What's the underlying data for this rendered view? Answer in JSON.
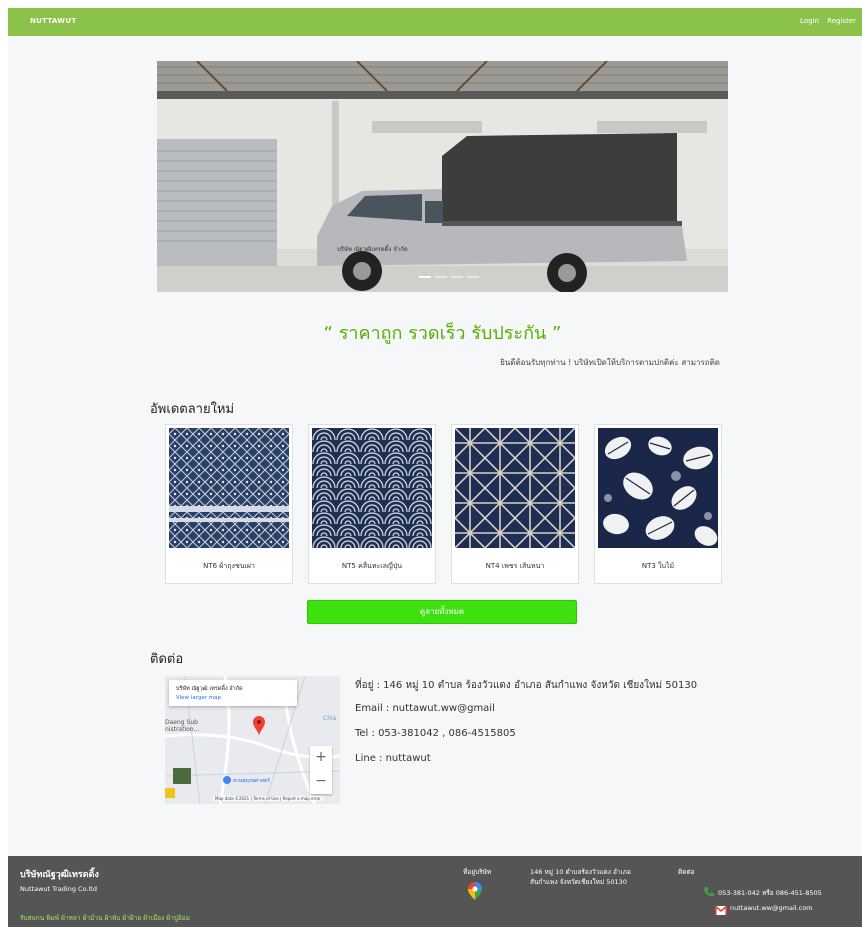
{
  "nav": {
    "brand": "NUTTAWUT",
    "login": "Login",
    "register": "Register"
  },
  "hero": {
    "truck_sign": "บริษัท ณัฐวุฒิเทรดดิ้ง จำกัด",
    "slides_count": 4,
    "active_slide": 1
  },
  "slogan": "“ ราคาถูก รวดเร็ว รับประกัน ”",
  "welcome": "ยินดีต้อนรับทุกท่าน ! บริษัทเปิดให้บริการตามปกติค่ะ สามารถติด",
  "new_patterns": {
    "heading": "อัพเดตลายใหม่",
    "items": [
      {
        "caption": "NT6  ผ้าถุงชนเผ่า"
      },
      {
        "caption": "NT5  คลื่นทะเลญี่ปุ่น"
      },
      {
        "caption": "NT4  เพชร เส้นหนา"
      },
      {
        "caption": "NT3  ใบไม้"
      }
    ],
    "view_all": "ดูลายทั้งหมด"
  },
  "contact": {
    "heading": "ติดต่อ",
    "address": "ที่อยู่ : 146 หมู่ 10 ตำบล ร้องวัวแดง อำเภอ สันกำแพง จังหวัด เชียงใหม่ 50130",
    "email": "Email : nuttawut.ww@gmail",
    "tel": "Tel : 053-381042 , 086-4515805",
    "line": "Line : nuttawut"
  },
  "map": {
    "place_title": "บริษัท ณัฐวุฒิ เทรดดิ้ง จำกัด",
    "view_larger": "View larger map",
    "zoom_in": "+",
    "zoom_out": "−",
    "footer": "Map data ©2021  |  Terms of Use  |  Report a map error",
    "label_left": "Daeng Sub",
    "label_left2": "nistration...",
    "label_chia": "Chia",
    "label_poi": "สวนพฤกษศาสตร์"
  },
  "footer": {
    "company_th": "บริษัทณัฐวุฒิเทรดดิ้ง",
    "company_en": "Nuttawut Trading Co.ltd",
    "services": "รับสแกน พิมพ์ ผ้าหลา ผ้าม้วน ผ้าพับ ผ้าฝ้าย ผ้าเมือง ผ้าปูอ้อม",
    "location_title": "ที่อยู่บริษัท",
    "address": "146 หมู่ 10 ตำบลร้องวัวแดง อำเภอ สันกำแพง จังหวัดเชียงใหม่ 50130",
    "contact_title": "ติดต่อ",
    "phone": "053-381-042 หรือ 086-451-8505",
    "email": "nuttawut.ww@gmail.com"
  },
  "colors": {
    "navbar": "#8bc34a",
    "slogan": "#55b000",
    "button": "#3ee010",
    "footer": "#555555"
  }
}
